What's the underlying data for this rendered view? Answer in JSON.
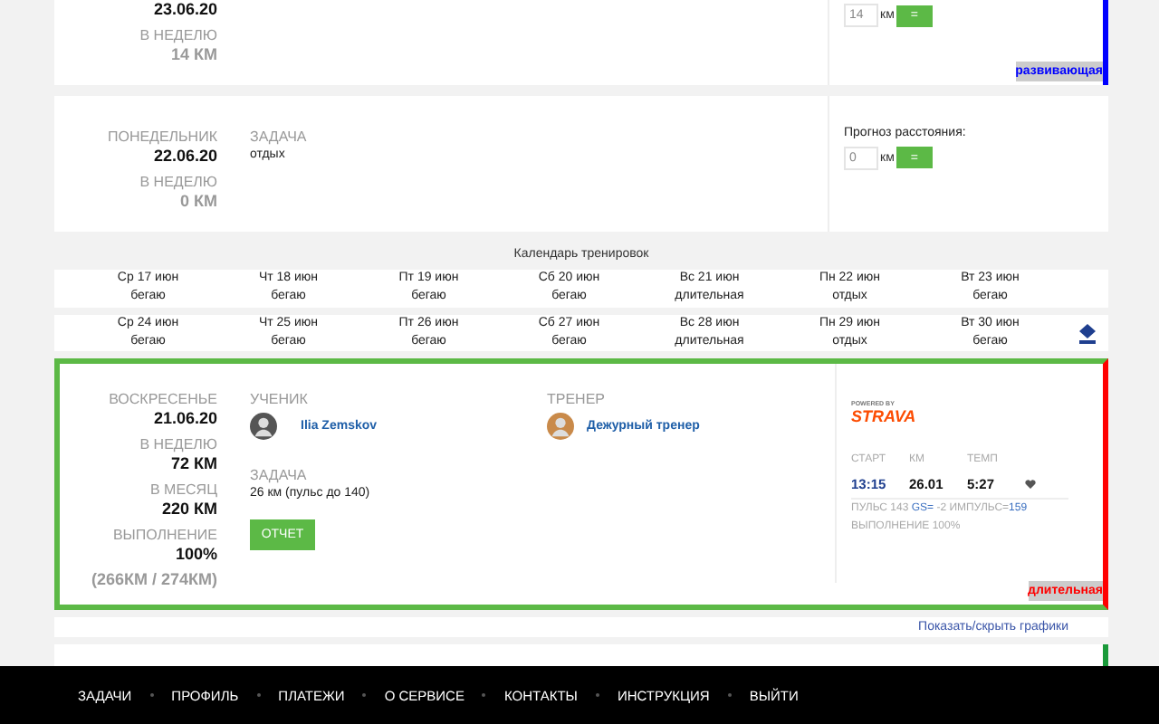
{
  "previous_card": {
    "date": "23.06.20",
    "week_label": "В НЕДЕЛЮ",
    "week_km": "14 КМ",
    "forecast_value": "14",
    "unit": "км",
    "button": "=",
    "tag": {
      "text": "развивающая",
      "color": "#0000ff"
    }
  },
  "monday_card": {
    "weekday": "ПОНЕДЕЛЬНИК",
    "date": "22.06.20",
    "week_label": "В НЕДЕЛЮ",
    "week_km": "0 КМ",
    "task_label": "ЗАДАЧА",
    "task": "отдых",
    "forecast_label": "Прогноз расстояния:",
    "forecast_value": "0",
    "unit": "км",
    "button": "="
  },
  "calendar": {
    "title": "Календарь тренировок",
    "weeks": [
      [
        {
          "day": "Ср 17 июн",
          "plan": "бегаю"
        },
        {
          "day": "Чт 18 июн",
          "plan": "бегаю"
        },
        {
          "day": "Пт 19 июн",
          "plan": "бегаю"
        },
        {
          "day": "Сб 20 июн",
          "plan": "бегаю"
        },
        {
          "day": "Вс 21 июн",
          "plan": "длительная"
        },
        {
          "day": "Пн 22 июн",
          "plan": "отдых"
        },
        {
          "day": "Вт 23 июн",
          "plan": "бегаю"
        }
      ],
      [
        {
          "day": "Ср 24 июн",
          "plan": "бегаю"
        },
        {
          "day": "Чт 25 июн",
          "plan": "бегаю"
        },
        {
          "day": "Пт 26 июн",
          "plan": "бегаю"
        },
        {
          "day": "Сб 27 июн",
          "plan": "бегаю"
        },
        {
          "day": "Вс 28 июн",
          "plan": "длительная"
        },
        {
          "day": "Пн 29 июн",
          "plan": "отдых"
        },
        {
          "day": "Вт 30 июн",
          "plan": "бегаю"
        }
      ]
    ]
  },
  "active_card": {
    "weekday": "ВОСКРЕСЕНЬЕ",
    "date": "21.06.20",
    "week_label": "В НЕДЕЛЮ",
    "week_km": "72 КМ",
    "month_label": "В МЕСЯЦ",
    "month_km": "220 КМ",
    "done_label": "ВЫПОЛНЕНИЕ",
    "done_pct": "100%",
    "done_detail": "(266КМ / 274КМ)",
    "student_label": "УЧЕНИК",
    "student": "Ilia Zemskov",
    "coach_label": "ТРЕНЕР",
    "coach": "Дежурный тренер",
    "task_label": "ЗАДАЧА",
    "task": "26 км (пульс до 140)",
    "report_button": "ОТЧЕТ",
    "powered_by": "POWERED BY",
    "brand": "STRAVA",
    "stats": [
      {
        "label": "СТАРТ",
        "value": "13:15",
        "kind": "accent"
      },
      {
        "label": "КМ",
        "value": "26.01",
        "kind": "plain"
      },
      {
        "label": "ТЕМП",
        "value": "5:27",
        "kind": "plain"
      }
    ],
    "pulse_parts": [
      {
        "text": "ПУЛЬС 143 ",
        "kind": "plain"
      },
      {
        "text": "GS=",
        "kind": "accent"
      },
      {
        "text": " -2 ИМПУЛЬС=",
        "kind": "plain"
      },
      {
        "text": "159",
        "kind": "accent"
      }
    ],
    "completion": "ВЫПОЛНЕНИЕ 100%",
    "tag": {
      "text": "длительная",
      "color": "#ff0000"
    }
  },
  "charts_link": "Показать/скрыть графики",
  "footer": [
    "ЗАДАЧИ",
    "ПРОФИЛЬ",
    "ПЛАТЕЖИ",
    "О СЕРВИСЕ",
    "КОНТАКТЫ",
    "ИНСТРУКЦИЯ",
    "ВЫЙТИ"
  ]
}
